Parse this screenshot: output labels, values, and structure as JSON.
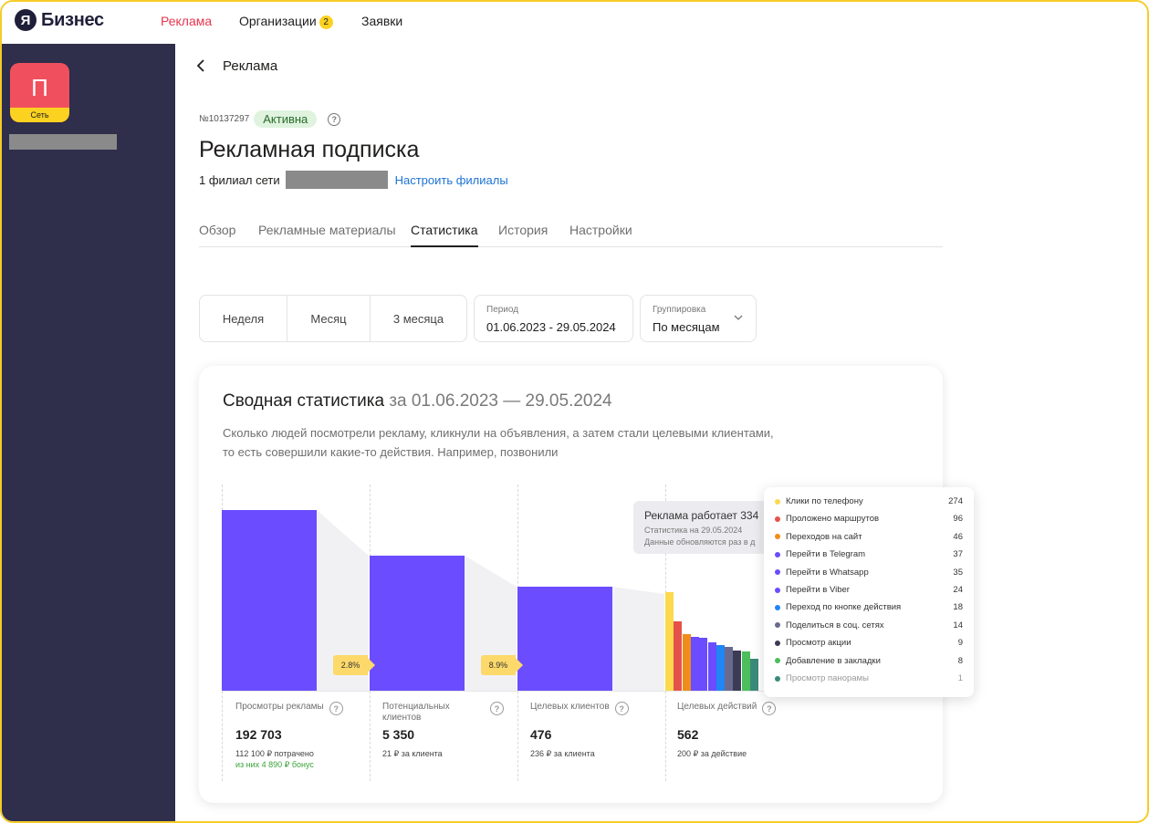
{
  "topbar": {
    "logo_letter": "Я",
    "logo_text": "Бизнес",
    "nav": [
      {
        "label": "Реклама"
      },
      {
        "label": "Организации",
        "badge": "2"
      },
      {
        "label": "Заявки"
      }
    ]
  },
  "sidebar": {
    "org_letter": "П",
    "org_tag": "Сеть"
  },
  "header": {
    "back_label": "Реклама",
    "order_number": "№10137297",
    "status": "Активна",
    "title": "Рекламная подписка",
    "branches_text": "1 филиал сети",
    "branches_link": "Настроить филиалы"
  },
  "tabs": [
    "Обзор",
    "Рекламные материалы",
    "Статистика",
    "История",
    "Настройки"
  ],
  "period_buttons": [
    "Неделя",
    "Месяц",
    "3 месяца"
  ],
  "period_field": {
    "label": "Период",
    "value": "01.06.2023 - 29.05.2024"
  },
  "grouping_field": {
    "label": "Группировка",
    "value": "По месяцам"
  },
  "summary": {
    "title": "Сводная статистика",
    "range": "за 01.06.2023 — 29.05.2024",
    "desc_line1": "Сколько людей посмотрели рекламу, кликнули на объявления, а затем стали целевыми клиентами,",
    "desc_line2": "то есть совершили какие-то действия. Например, позвонили"
  },
  "metrics": [
    {
      "label": "Просмотры рекламы",
      "value": "192 703",
      "sub": "112 100 ₽ потрачено",
      "bonus": "из них 4 890 ₽ бонус"
    },
    {
      "label": "Потенциальных клиентов",
      "value": "5 350",
      "sub": "21 ₽ за клиента"
    },
    {
      "label": "Целевых клиентов",
      "value": "476",
      "sub": "236 ₽ за клиента"
    },
    {
      "label": "Целевых действий",
      "value": "562",
      "sub": "200 ₽ за действие"
    }
  ],
  "conversions": [
    "2.8%",
    "8.9%"
  ],
  "tooltip": {
    "title": "Реклама работает 334",
    "line1": "Статистика на 29.05.2024",
    "line2": "Данные обновляются раз в д"
  },
  "actions_legend": [
    {
      "label": "Клики по телефону",
      "value": "274",
      "color": "#fcd94d"
    },
    {
      "label": "Проложено маршрутов",
      "value": "96",
      "color": "#e5524a"
    },
    {
      "label": "Переходов на сайт",
      "value": "46",
      "color": "#f08c1a"
    },
    {
      "label": "Перейти в Telegram",
      "value": "37",
      "color": "#6b4cff"
    },
    {
      "label": "Перейти в Whatsapp",
      "value": "35",
      "color": "#6b4cff"
    },
    {
      "label": "Перейти в Viber",
      "value": "24",
      "color": "#6b4cff"
    },
    {
      "label": "Переход по кнопке действия",
      "value": "18",
      "color": "#1f86f5"
    },
    {
      "label": "Поделиться в соц. сетях",
      "value": "14",
      "color": "#6a6a8e"
    },
    {
      "label": "Просмотр акции",
      "value": "9",
      "color": "#3b3b55"
    },
    {
      "label": "Добавление в закладки",
      "value": "8",
      "color": "#4cbe5c"
    },
    {
      "label": "Просмотр панорамы",
      "value": "1",
      "color": "#3a8a7a"
    }
  ],
  "colors": {
    "accent": "#6b4cff",
    "nav_active": "#e8344e",
    "link": "#1c73d4",
    "sidebar": "#2f2e4b",
    "highlight": "#fcd221"
  }
}
